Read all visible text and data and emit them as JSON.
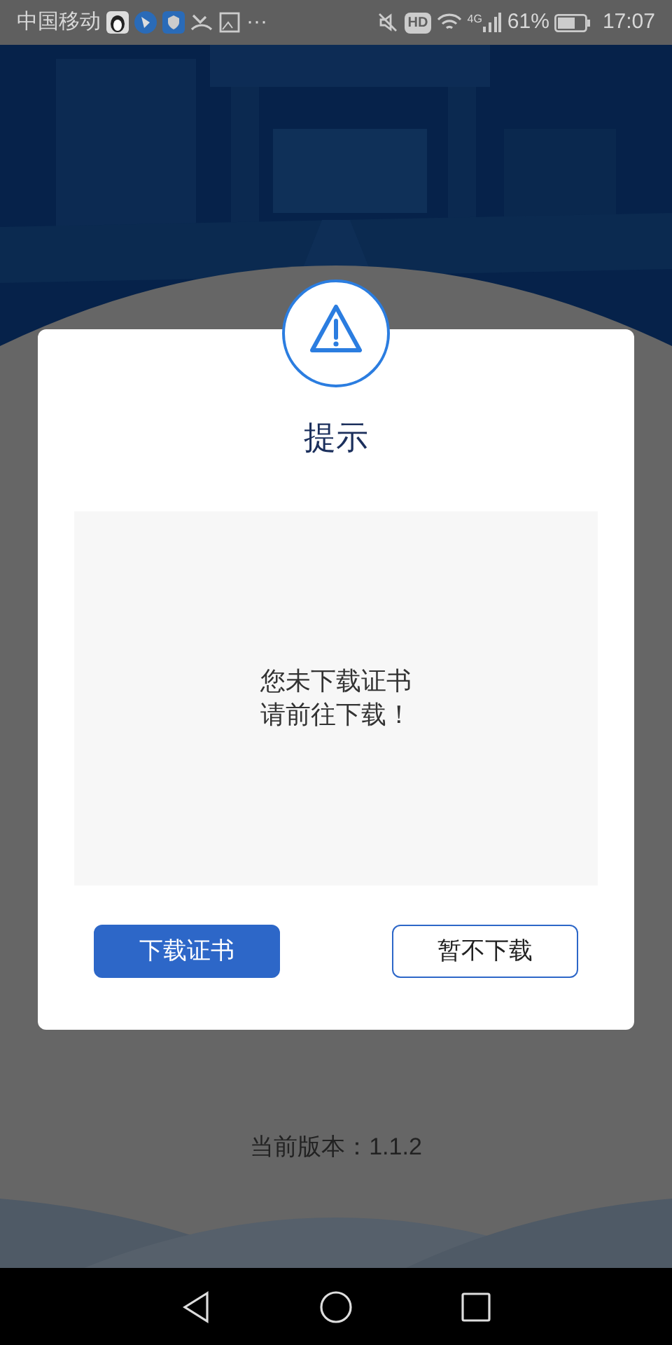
{
  "status_bar": {
    "carrier": "中国移动",
    "more": "···",
    "hd": "HD",
    "network": "4G",
    "battery": "61%",
    "time": "17:07"
  },
  "dialog": {
    "title": "提示",
    "message_lines": [
      "您未下载证书",
      "请前往下载！"
    ],
    "buttons": [
      {
        "label": "下载证书",
        "kind": "primary"
      },
      {
        "label": "暂不下载",
        "kind": "outline"
      }
    ]
  },
  "version": "当前版本：1.1.2"
}
